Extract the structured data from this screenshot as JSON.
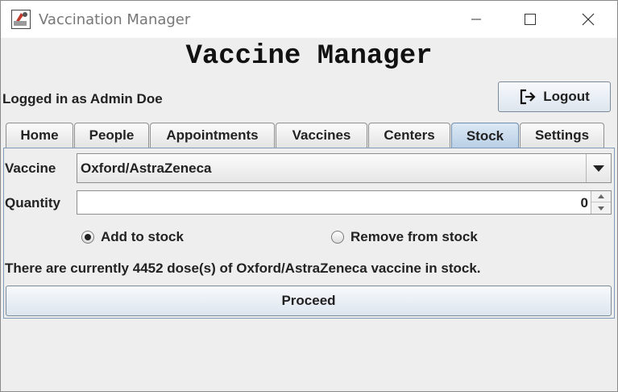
{
  "window": {
    "title": "Vaccination Manager",
    "icon": "vaccine-app-icon"
  },
  "header": {
    "title": "Vaccine Manager",
    "login_text": "Logged in as Admin Doe",
    "logout_label": "Logout"
  },
  "tabs": [
    {
      "label": "Home"
    },
    {
      "label": "People"
    },
    {
      "label": "Appointments"
    },
    {
      "label": "Vaccines"
    },
    {
      "label": "Centers"
    },
    {
      "label": "Stock",
      "active": true
    },
    {
      "label": "Settings"
    }
  ],
  "stock": {
    "vaccine_label": "Vaccine",
    "vaccine_value": "Oxford/AstraZeneca",
    "quantity_label": "Quantity",
    "quantity_value": "0",
    "radio_add": "Add to stock",
    "radio_remove": "Remove from stock",
    "selected": "add",
    "info": "There are currently 4452 dose(s) of Oxford/AstraZeneca vaccine in stock.",
    "proceed_label": "Proceed"
  },
  "colors": {
    "active_tab": "#b8cfe6",
    "panel_border": "#7e9bb9"
  }
}
